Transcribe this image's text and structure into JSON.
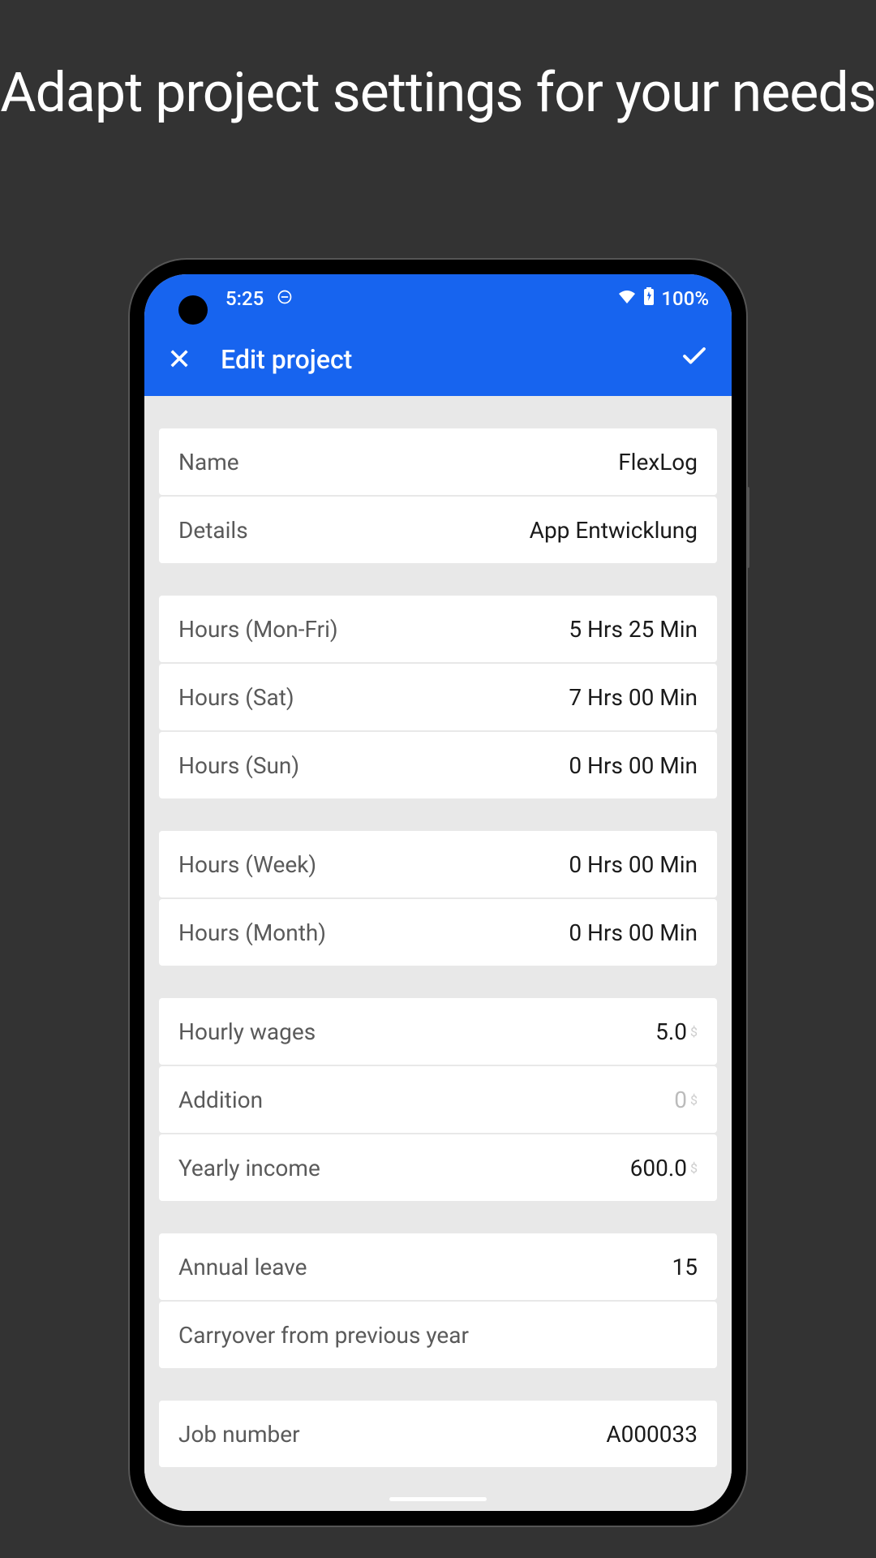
{
  "promo": {
    "title": "Adapt project settings for your needs"
  },
  "statusBar": {
    "time": "5:25",
    "battery": "100%"
  },
  "appBar": {
    "title": "Edit project"
  },
  "fields": {
    "name": {
      "label": "Name",
      "value": "FlexLog"
    },
    "details": {
      "label": "Details",
      "value": "App Entwicklung"
    },
    "hoursMonFri": {
      "label": "Hours (Mon-Fri)",
      "value": "5 Hrs 25 Min"
    },
    "hoursSat": {
      "label": "Hours (Sat)",
      "value": "7 Hrs 00 Min"
    },
    "hoursSun": {
      "label": "Hours (Sun)",
      "value": "0 Hrs 00 Min"
    },
    "hoursWeek": {
      "label": "Hours (Week)",
      "value": "0 Hrs 00 Min"
    },
    "hoursMonth": {
      "label": "Hours (Month)",
      "value": "0 Hrs 00 Min"
    },
    "hourlyWages": {
      "label": "Hourly wages",
      "value": "5.0",
      "currency": "$"
    },
    "addition": {
      "label": "Addition",
      "value": "0",
      "currency": "$"
    },
    "yearlyIncome": {
      "label": "Yearly income",
      "value": "600.0",
      "currency": "$"
    },
    "annualLeave": {
      "label": "Annual leave",
      "value": "15"
    },
    "carryover": {
      "label": "Carryover from previous year",
      "value": ""
    },
    "jobNumber": {
      "label": "Job number",
      "value": "A000033"
    }
  }
}
